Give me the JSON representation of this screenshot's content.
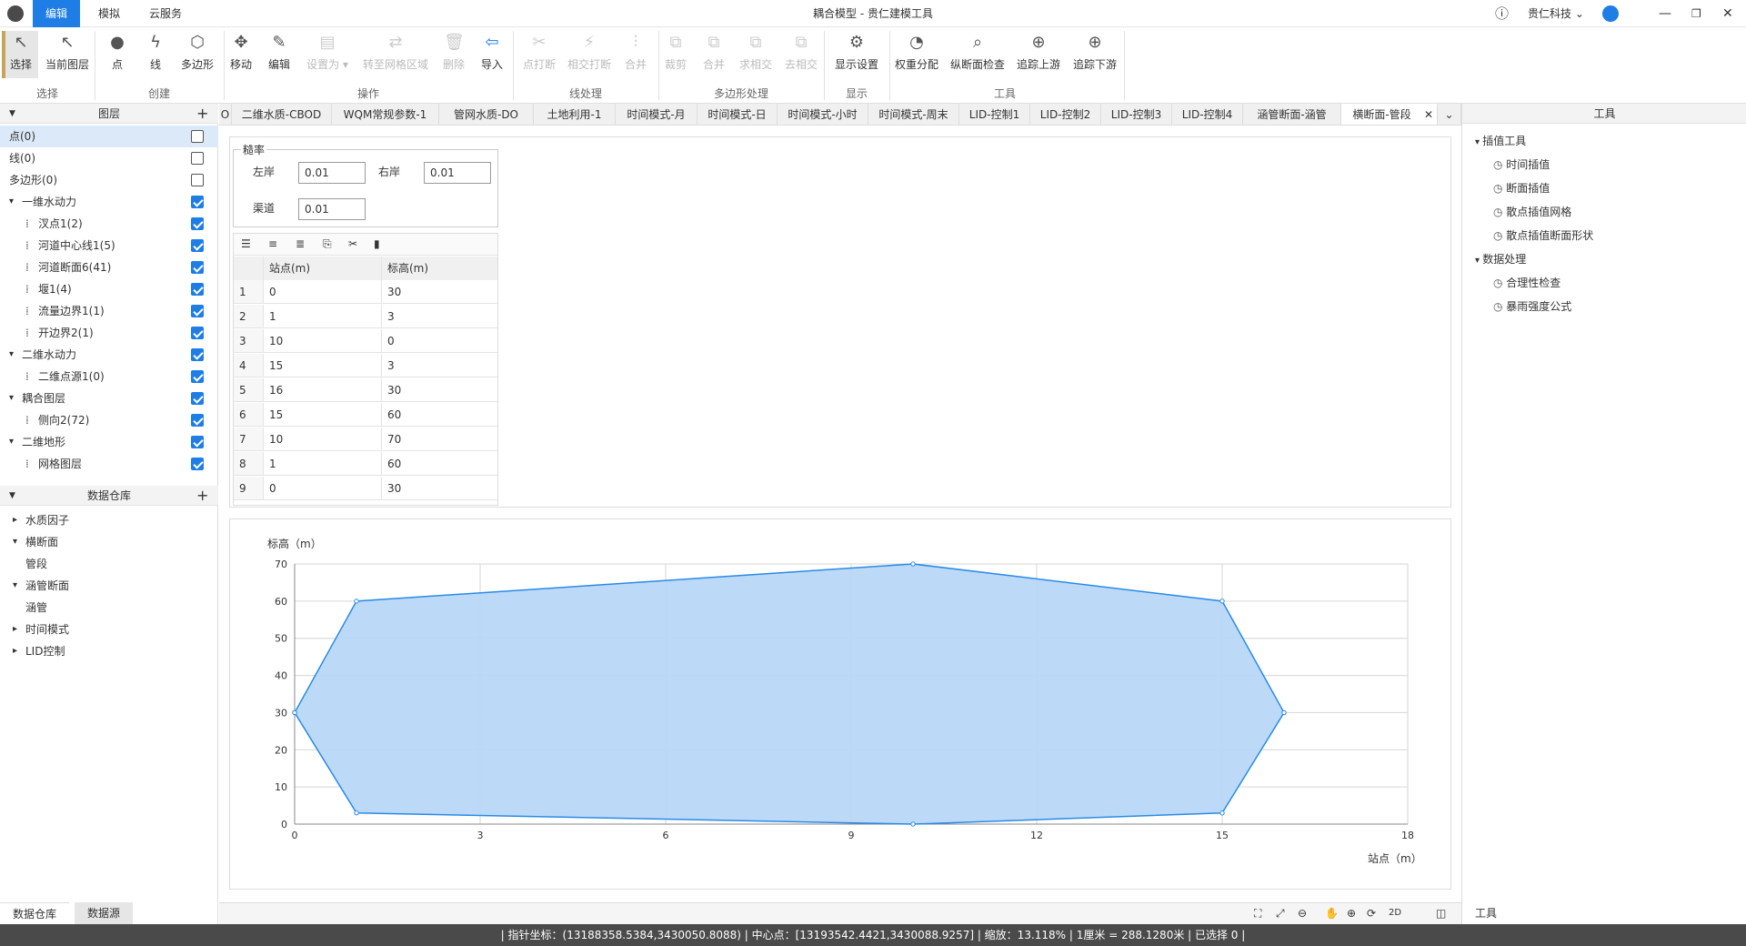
{
  "app": {
    "title": "耦合模型 - 贵仁建模工具",
    "menus": [
      "编辑",
      "模拟",
      "云服务"
    ],
    "company": "贵仁科技"
  },
  "toolbar": {
    "buttons": [
      {
        "label": "选择",
        "icon": "cursor-icon",
        "enabled": true
      },
      {
        "label": "当前图层",
        "icon": "layer-cursor-icon",
        "enabled": true
      },
      {
        "label": "点",
        "icon": "dot-icon",
        "enabled": true
      },
      {
        "label": "线",
        "icon": "line-icon",
        "enabled": true
      },
      {
        "label": "多边形",
        "icon": "polygon-icon",
        "enabled": true
      },
      {
        "label": "移动",
        "icon": "move-icon",
        "enabled": true
      },
      {
        "label": "编辑",
        "icon": "pencil-icon",
        "enabled": true
      },
      {
        "label": "设置为",
        "icon": "set-as-icon",
        "enabled": false
      },
      {
        "label": "转至网格区域",
        "icon": "grid-goto-icon",
        "enabled": false
      },
      {
        "label": "删除",
        "icon": "trash-icon",
        "enabled": false
      },
      {
        "label": "导入",
        "icon": "import-icon",
        "enabled": true
      },
      {
        "label": "点打断",
        "icon": "point-break-icon",
        "enabled": false
      },
      {
        "label": "相交打断",
        "icon": "intersect-break-icon",
        "enabled": false
      },
      {
        "label": "合并",
        "icon": "merge-icon",
        "enabled": false
      },
      {
        "label": "裁剪",
        "icon": "clip-icon",
        "enabled": false
      },
      {
        "label": "合并",
        "icon": "union-icon",
        "enabled": false
      },
      {
        "label": "求相交",
        "icon": "intersect-icon",
        "enabled": false
      },
      {
        "label": "去相交",
        "icon": "remove-intersect-icon",
        "enabled": false
      },
      {
        "label": "显示设置",
        "icon": "gear-icon",
        "enabled": true
      },
      {
        "label": "权重分配",
        "icon": "pie-icon",
        "enabled": true
      },
      {
        "label": "纵断面检查",
        "icon": "profile-check-icon",
        "enabled": true
      },
      {
        "label": "追踪上游",
        "icon": "trace-up-icon",
        "enabled": true
      },
      {
        "label": "追踪下游",
        "icon": "trace-down-icon",
        "enabled": true
      }
    ],
    "groups": [
      "选择",
      "创建",
      "操作",
      "线处理",
      "多边形处理",
      "显示",
      "工具"
    ]
  },
  "layers_panel": {
    "title": "图层",
    "items": [
      {
        "label": "点(0)",
        "level": 0,
        "checked": false,
        "selected": true
      },
      {
        "label": "线(0)",
        "level": 0,
        "checked": false
      },
      {
        "label": "多边形(0)",
        "level": 0,
        "checked": false
      },
      {
        "label": "一维水动力",
        "level": 0,
        "checked": true,
        "expanded": true
      },
      {
        "label": "汊点1(2)",
        "level": 1,
        "checked": true
      },
      {
        "label": "河道中心线1(5)",
        "level": 1,
        "checked": true
      },
      {
        "label": "河道断面6(41)",
        "level": 1,
        "checked": true
      },
      {
        "label": "堰1(4)",
        "level": 1,
        "checked": true
      },
      {
        "label": "流量边界1(1)",
        "level": 1,
        "checked": true
      },
      {
        "label": "开边界2(1)",
        "level": 1,
        "checked": true
      },
      {
        "label": "二维水动力",
        "level": 0,
        "checked": true,
        "expanded": true
      },
      {
        "label": "二维点源1(0)",
        "level": 1,
        "checked": true
      },
      {
        "label": "耦合图层",
        "level": 0,
        "checked": true,
        "expanded": true
      },
      {
        "label": "侧向2(72)",
        "level": 1,
        "checked": true
      },
      {
        "label": "二维地形",
        "level": 0,
        "checked": true,
        "expanded": true
      },
      {
        "label": "网格图层",
        "level": 1,
        "checked": true
      }
    ]
  },
  "warehouse_panel": {
    "title": "数据仓库",
    "items": [
      {
        "label": "水质因子",
        "level": 0,
        "expanded": false
      },
      {
        "label": "横断面",
        "level": 0,
        "expanded": true
      },
      {
        "label": "管段",
        "level": 1
      },
      {
        "label": "涵管断面",
        "level": 0,
        "expanded": true
      },
      {
        "label": "涵管",
        "level": 1
      },
      {
        "label": "时间模式",
        "level": 0,
        "expanded": false
      },
      {
        "label": "LID控制",
        "level": 0,
        "expanded": false
      }
    ],
    "bottom_tabs": [
      "数据仓库",
      "数据源"
    ]
  },
  "tabs": [
    "O",
    "二维水质-CBOD",
    "WQM常规参数-1",
    "管网水质-DO",
    "土地利用-1",
    "时间模式-月",
    "时间模式-日",
    "时间模式-小时",
    "时间模式-周末",
    "LID-控制1",
    "LID-控制2",
    "LID-控制3",
    "LID-控制4",
    "涵管断面-涵管",
    "横断面-管段"
  ],
  "roughness": {
    "legend": "糙率",
    "left_bank_label": "左岸",
    "left_bank": "0.01",
    "right_bank_label": "右岸",
    "right_bank": "0.01",
    "channel_label": "渠道",
    "channel": "0.01"
  },
  "table": {
    "headers": [
      "站点(m)",
      "标高(m)"
    ],
    "rows": [
      [
        "1",
        "0",
        "30"
      ],
      [
        "2",
        "1",
        "3"
      ],
      [
        "3",
        "10",
        "0"
      ],
      [
        "4",
        "15",
        "3"
      ],
      [
        "5",
        "16",
        "30"
      ],
      [
        "6",
        "15",
        "60"
      ],
      [
        "7",
        "10",
        "70"
      ],
      [
        "8",
        "1",
        "60"
      ],
      [
        "9",
        "0",
        "30"
      ]
    ]
  },
  "chart_data": {
    "type": "area",
    "x": [
      0,
      1,
      10,
      15,
      16,
      15,
      10,
      1,
      0
    ],
    "y": [
      30,
      3,
      0,
      3,
      30,
      60,
      70,
      60,
      30
    ],
    "xlabel": "站点（m）",
    "ylabel": "标高（m）",
    "xlim": [
      0,
      18
    ],
    "ylim": [
      0,
      70
    ],
    "xticks": [
      0,
      3,
      6,
      9,
      12,
      15,
      18
    ],
    "yticks": [
      0,
      10,
      20,
      30,
      40,
      50,
      60,
      70
    ],
    "grid": true,
    "fill_color": "#b8d8f8",
    "line_color": "#2a8ae6"
  },
  "tools_panel": {
    "title": "工具",
    "groups": [
      {
        "label": "插值工具",
        "items": [
          "时间插值",
          "断面插值",
          "散点插值网格",
          "散点插值断面形状"
        ]
      },
      {
        "label": "数据处理",
        "items": [
          "合理性检查",
          "暴雨强度公式"
        ]
      }
    ],
    "bottom_tab": "工具"
  },
  "statusbar": {
    "text": "|   指针坐标：(13188358.5384,3430050.8088)   |   中心点：[13193542.4421,3430088.9257]   |   缩放：13.118%   |   1厘米 = 288.1280米   |   已选择 0   |"
  },
  "mapbar": {
    "mode": "2D"
  }
}
